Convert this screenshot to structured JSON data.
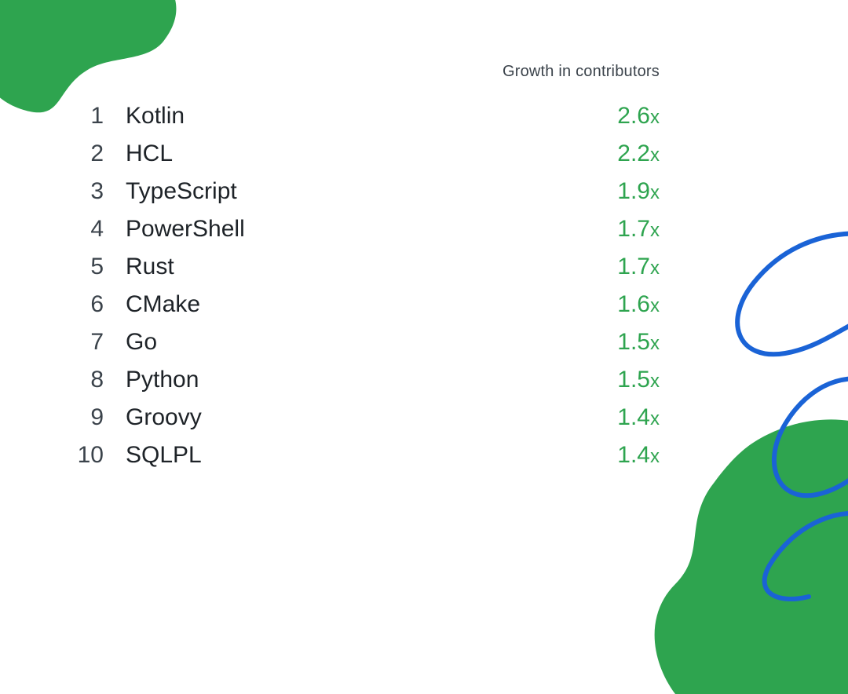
{
  "header": {
    "label": "Growth in contributors"
  },
  "colors": {
    "accent": "#2ea44f",
    "text": "#1e2328",
    "muted": "#3b434b",
    "squiggle": "#1a63d6"
  },
  "rows": [
    {
      "rank": "1",
      "name": "Kotlin",
      "value": "2.6",
      "suffix": "x"
    },
    {
      "rank": "2",
      "name": "HCL",
      "value": "2.2",
      "suffix": "x"
    },
    {
      "rank": "3",
      "name": "TypeScript",
      "value": "1.9",
      "suffix": "x"
    },
    {
      "rank": "4",
      "name": "PowerShell",
      "value": "1.7",
      "suffix": "x"
    },
    {
      "rank": "5",
      "name": "Rust",
      "value": "1.7",
      "suffix": "x"
    },
    {
      "rank": "6",
      "name": "CMake",
      "value": "1.6",
      "suffix": "x"
    },
    {
      "rank": "7",
      "name": "Go",
      "value": "1.5",
      "suffix": "x"
    },
    {
      "rank": "8",
      "name": "Python",
      "value": "1.5",
      "suffix": "x"
    },
    {
      "rank": "9",
      "name": "Groovy",
      "value": "1.4",
      "suffix": "x"
    },
    {
      "rank": "10",
      "name": "SQLPL",
      "value": "1.4",
      "suffix": "x"
    }
  ],
  "chart_data": {
    "type": "table",
    "title": "Growth in contributors",
    "xlabel": "",
    "ylabel": "",
    "categories": [
      "Kotlin",
      "HCL",
      "TypeScript",
      "PowerShell",
      "Rust",
      "CMake",
      "Go",
      "Python",
      "Groovy",
      "SQLPL"
    ],
    "values": [
      2.6,
      2.2,
      1.9,
      1.7,
      1.7,
      1.6,
      1.5,
      1.5,
      1.4,
      1.4
    ],
    "unit": "x"
  }
}
